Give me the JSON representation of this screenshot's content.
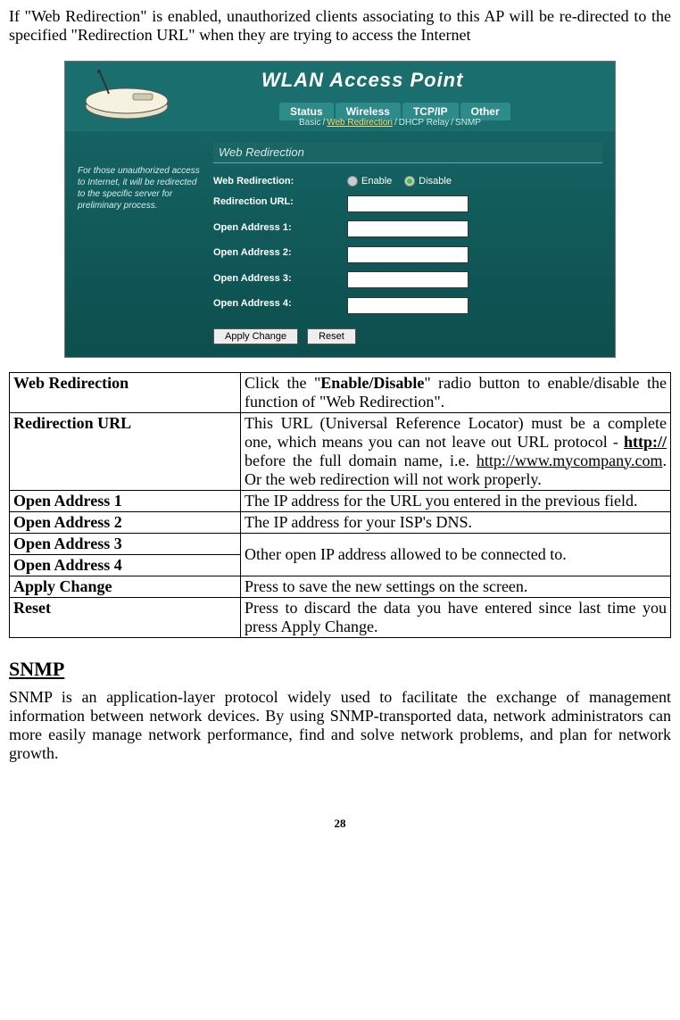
{
  "intro": "If \"Web Redirection\" is enabled, unauthorized clients associating to this AP will be re-directed to the specified \"Redirection URL\" when they are trying to access the Internet",
  "ap": {
    "title": "WLAN Access Point",
    "tabs": [
      "Status",
      "Wireless",
      "TCP/IP",
      "Other"
    ],
    "subnav": [
      "Basic",
      "Web Redirection",
      "DHCP Relay",
      "SNMP"
    ],
    "sidebar_note": "For those unauthorized access to Internet, it will be redirected to the specific server for preliminary process.",
    "panel_title": "Web Redirection",
    "fields": {
      "web_redirection": "Web Redirection:",
      "enable": "Enable",
      "disable": "Disable",
      "redir_url": "Redirection URL:",
      "oa1": "Open Address 1:",
      "oa2": "Open Address 2:",
      "oa3": "Open Address 3:",
      "oa4": "Open Address 4:"
    },
    "buttons": {
      "apply": "Apply Change",
      "reset": "Reset"
    }
  },
  "table": {
    "r0k": "Web Redirection",
    "r0v_pre": "Click the \"",
    "r0v_bold": "Enable/Disable",
    "r0v_post": "\" radio button to enable/disable the function of \"Web Redirection\".",
    "r1k": "Redirection URL",
    "r1v_a": "This URL (Universal Reference Locator) must be a complete one, which means you can not leave out URL protocol - ",
    "r1v_b": "http://",
    "r1v_c": " before the full domain name, i.e. ",
    "r1v_d": "http://www.mycompany.com",
    "r1v_e": ". Or the web redirection will not work properly.",
    "r2k": "Open Address 1",
    "r2v": "The IP address for the URL you entered in the previous field.",
    "r3k": "Open Address 2",
    "r3v": "The IP address for your ISP's DNS.",
    "r4k": "Open Address 3",
    "r5k": "Open Address 4",
    "r45v": "Other open IP address allowed to be connected to.",
    "r6k": "Apply Change",
    "r6v": "Press to save the new settings on the screen.",
    "r7k": "Reset",
    "r7v": "Press to discard the data you have entered since last time you press Apply Change."
  },
  "snmp": {
    "heading": "SNMP",
    "body": "SNMP is an application-layer protocol widely used to facilitate the exchange of management information between network devices.  By using SNMP-transported data, network administrators can more easily manage network performance, find and solve network problems, and plan for network growth."
  },
  "page_number": "28"
}
